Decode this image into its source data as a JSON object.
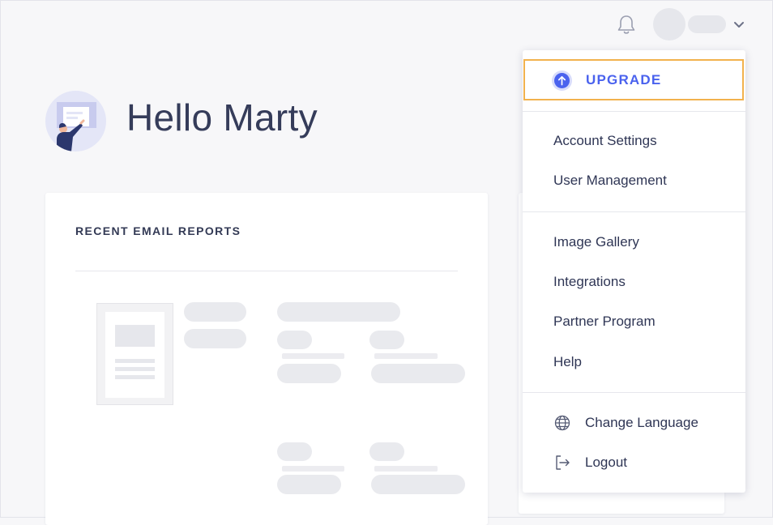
{
  "header": {
    "notifications_icon": "bell-icon",
    "account_menu_icon": "chevron-down-icon"
  },
  "greeting": {
    "text": "Hello Marty",
    "illustration": "person-at-board-illustration"
  },
  "card": {
    "title": "RECENT EMAIL REPORTS"
  },
  "menu": {
    "upgrade_label": "UPGRADE",
    "upgrade_icon": "arrow-up-circle-icon",
    "section1": [
      "Account Settings",
      "User Management"
    ],
    "section2": [
      "Image Gallery",
      "Integrations",
      "Partner Program",
      "Help"
    ],
    "change_language": "Change Language",
    "change_language_icon": "globe-icon",
    "logout": "Logout",
    "logout_icon": "logout-icon"
  },
  "colors": {
    "accent": "#4a62ee",
    "upgrade_border": "#f2b24d",
    "text": "#2f3655",
    "skeleton": "#e9eaee"
  }
}
